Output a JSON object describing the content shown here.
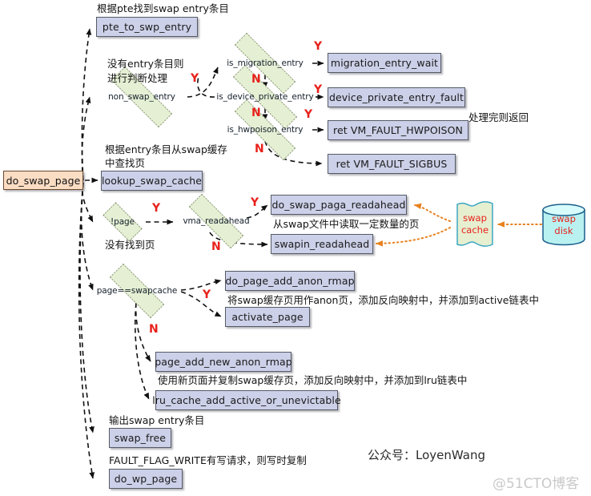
{
  "diagram": {
    "title_brand": "公众号：LoyenWang",
    "watermark": "@51CTO博客",
    "entry_node": {
      "label": "do_swap_page"
    },
    "nodes": [
      {
        "id": "pte_to_swp_entry",
        "label": "pte_to_swp_entry"
      },
      {
        "id": "migration_entry_wait",
        "label": "migration_entry_wait"
      },
      {
        "id": "device_private_entry_fault",
        "label": "device_private_entry_fault"
      },
      {
        "id": "ret_hwpoison",
        "label": "ret VM_FAULT_HWPOISON"
      },
      {
        "id": "ret_sigbus",
        "label": "ret VM_FAULT_SIGBUS"
      },
      {
        "id": "lookup_swap_cache",
        "label": "lookup_swap_cache"
      },
      {
        "id": "do_swap_paga_readahead",
        "label": "do_swap_paga_readahead"
      },
      {
        "id": "swapin_readahead",
        "label": "swapin_readahead"
      },
      {
        "id": "do_page_add_anon_rmap",
        "label": "do_page_add_anon_rmap"
      },
      {
        "id": "activate_page",
        "label": "activate_page"
      },
      {
        "id": "page_add_new_anon_rmap",
        "label": "page_add_new_anon_rmap"
      },
      {
        "id": "lru_cache_add",
        "label": "lru_cache_add_active_or_unevictable"
      },
      {
        "id": "swap_free",
        "label": "swap_free"
      },
      {
        "id": "do_wp_page",
        "label": "do_wp_page"
      }
    ],
    "decisions": [
      {
        "id": "non_swap_entry",
        "label": "non_swap_entry"
      },
      {
        "id": "is_migration_entry",
        "label": "is_migration_entry"
      },
      {
        "id": "is_device_private_entry",
        "label": "is_device_private_entry"
      },
      {
        "id": "is_hwpoison_entry",
        "label": "is_hwpoison_entry"
      },
      {
        "id": "not_page",
        "label": "!page"
      },
      {
        "id": "vma_readahead",
        "label": "vma_readahead"
      },
      {
        "id": "page_eq_swapcache",
        "label": "page==swapcache"
      }
    ],
    "storage": [
      {
        "id": "swap_cache",
        "line1": "swap",
        "line2": "cache"
      },
      {
        "id": "swap_disk",
        "line1": "swap",
        "line2": "disk"
      }
    ],
    "annotations": [
      {
        "id": "a1",
        "text": "根据pte找到swap entry条目"
      },
      {
        "id": "a2a",
        "text": "没有entry条目则"
      },
      {
        "id": "a2b",
        "text": "进行判断处理"
      },
      {
        "id": "a3",
        "text": "处理完则返回"
      },
      {
        "id": "a4a",
        "text": "根据entry条目从swap缓存"
      },
      {
        "id": "a4b",
        "text": "中查找页"
      },
      {
        "id": "a5",
        "text": "没有找到页"
      },
      {
        "id": "a6",
        "text": "从swap文件中读取一定数量的页"
      },
      {
        "id": "a7",
        "text": "将swap缓存页用作anon页，添加反向映射中，并添加到active链表中"
      },
      {
        "id": "a8",
        "text": "使用新页面并复制swap缓存页，添加反向映射中，并添加到lru链表中"
      },
      {
        "id": "a9",
        "text": "输出swap entry条目"
      },
      {
        "id": "a10",
        "text": "FAULT_FLAG_WRITE有写请求，则写时复制"
      }
    ],
    "branch_labels": [
      {
        "id": "y1",
        "text": "Y"
      },
      {
        "id": "y2",
        "text": "Y"
      },
      {
        "id": "y3",
        "text": "Y"
      },
      {
        "id": "y4",
        "text": "Y"
      },
      {
        "id": "y5",
        "text": "Y"
      },
      {
        "id": "y6",
        "text": "Y"
      },
      {
        "id": "y7",
        "text": "Y"
      },
      {
        "id": "n1",
        "text": "N"
      },
      {
        "id": "n2",
        "text": "N"
      },
      {
        "id": "n3",
        "text": "N"
      },
      {
        "id": "n4",
        "text": "N"
      },
      {
        "id": "n5",
        "text": "N"
      }
    ],
    "colors": {
      "process_fill": "#ccd0e8",
      "process_border": "#555b66",
      "entry_fill": "#fbddc4",
      "entry_border": "#6c4a2e",
      "decision_fill": "#e5efd4",
      "decision_border": "#6b7a56",
      "branch_label": "#e8211b",
      "storage_fill_cache": "#e6efd0",
      "storage_fill_disk": "#b9f1f1",
      "storage_text": "#e8211b",
      "storage_edge": "#e8821e",
      "edge": "#1a1a1a"
    }
  }
}
